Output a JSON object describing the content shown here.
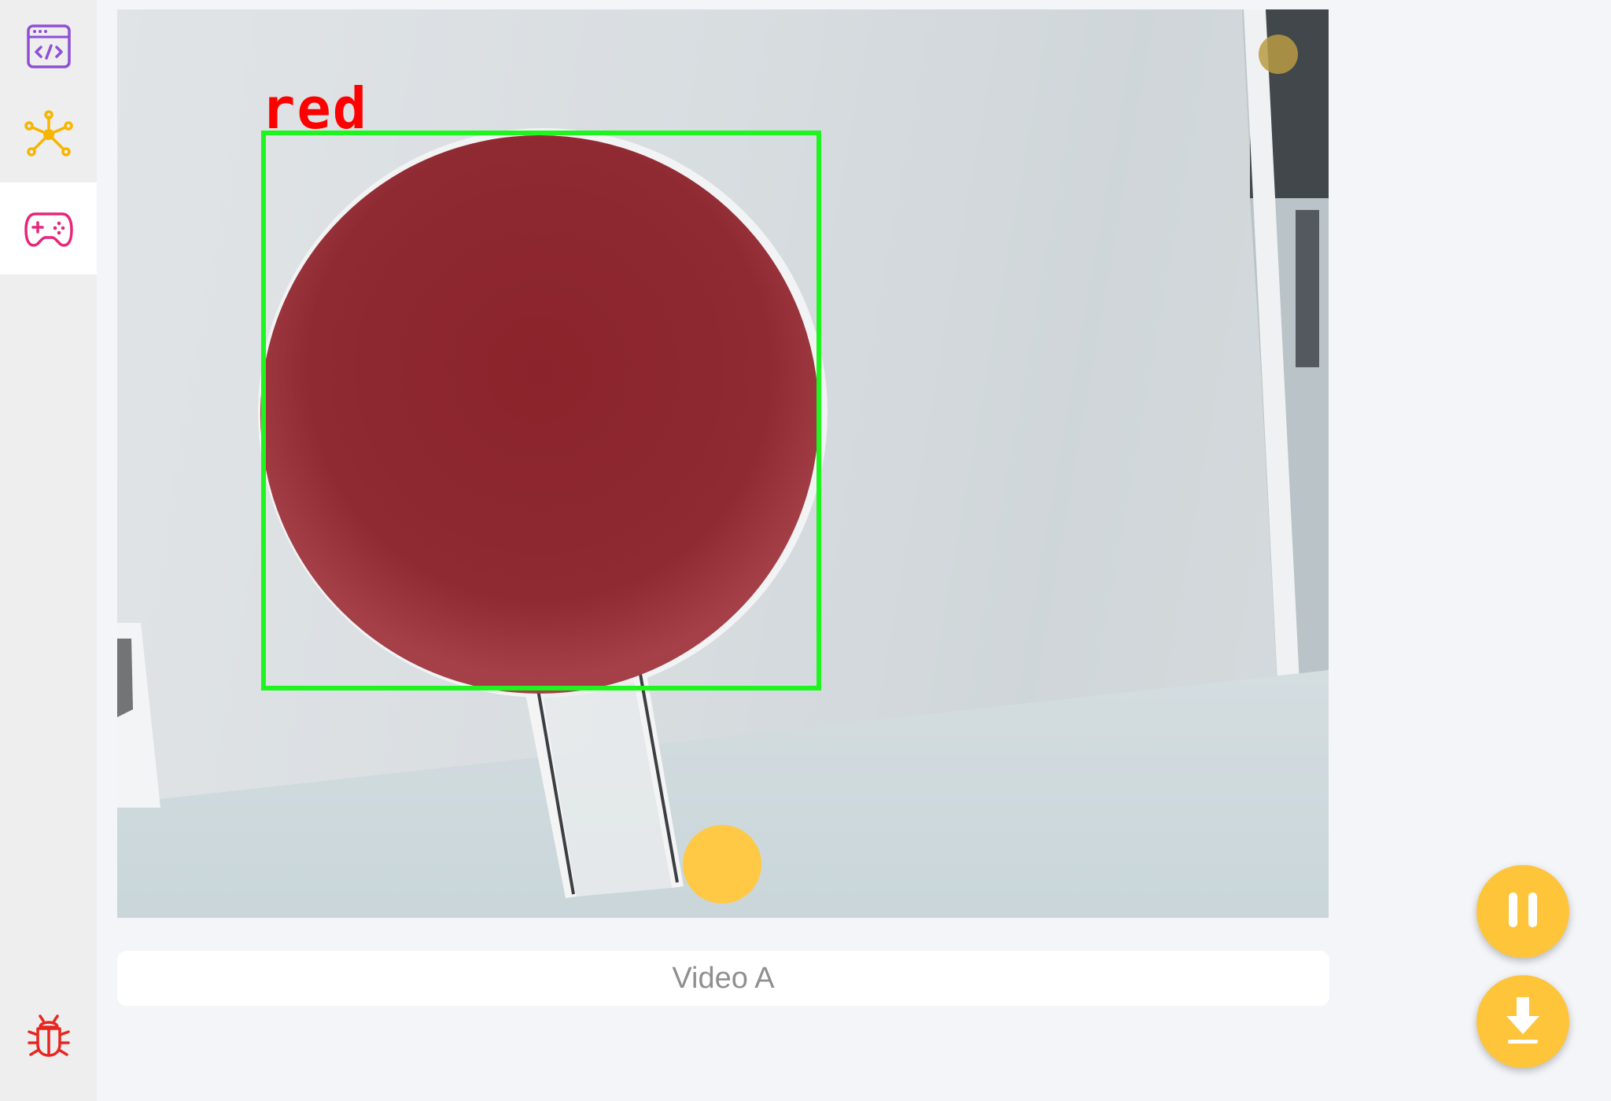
{
  "sidebar": {
    "items": [
      {
        "name": "code",
        "icon": "code-window-icon",
        "color": "#8e4fd6",
        "active": false
      },
      {
        "name": "network",
        "icon": "node-network-icon",
        "color": "#f7b500",
        "active": false
      },
      {
        "name": "gamepad",
        "icon": "gamepad-icon",
        "color": "#e6267a",
        "active": true
      },
      {
        "name": "debug",
        "icon": "bug-icon",
        "color": "#e6261f",
        "active": false
      }
    ]
  },
  "video": {
    "detection_label": "red",
    "detection_box_color": "#1ef51e",
    "detection_label_color": "#ff0000",
    "caption": "Video A"
  },
  "controls": {
    "pause_icon": "pause-icon",
    "download_icon": "download-icon",
    "accent_color": "#fec43a"
  }
}
